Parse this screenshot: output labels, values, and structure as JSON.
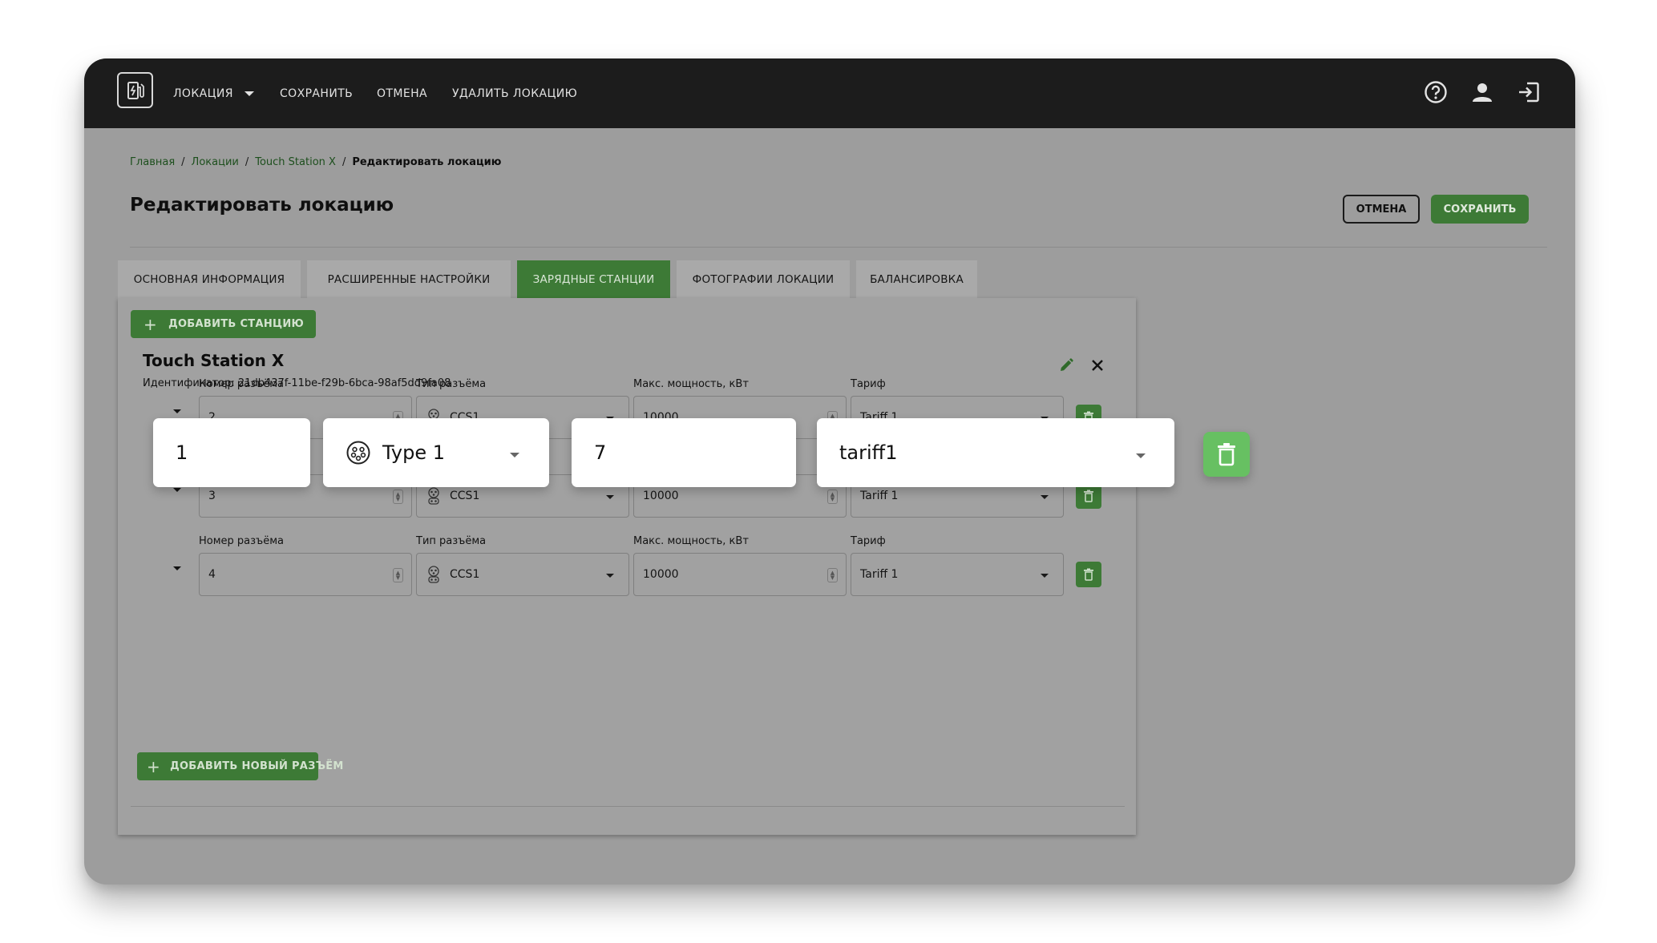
{
  "colors": {
    "accent": "#3d7a36",
    "topbar": "#1c1c1c",
    "highlight_trash": "#67c062"
  },
  "topbar": {
    "nav": {
      "location": "ЛОКАЦИЯ",
      "save": "СОХРАНИТЬ",
      "cancel": "ОТМЕНА",
      "delete_location": "УДАЛИТЬ ЛОКАЦИЮ"
    },
    "icons": [
      "charging-station-icon",
      "help-icon",
      "account-icon",
      "logout-icon"
    ]
  },
  "breadcrumb": {
    "home": "Главная",
    "locations": "Локации",
    "station": "Touch Station X",
    "current": "Редактировать локацию"
  },
  "page": {
    "title": "Редактировать локацию",
    "cancel_label": "ОТМЕНА",
    "save_label": "СОХРАНИТЬ"
  },
  "tabs": [
    {
      "label": "ОСНОВНАЯ ИНФОРМАЦИЯ",
      "active": false
    },
    {
      "label": "РАСШИРЕННЫЕ НАСТРОЙКИ",
      "active": false
    },
    {
      "label": "ЗАРЯДНЫЕ СТАНЦИИ",
      "active": true
    },
    {
      "label": "ФОТОГРАФИИ ЛОКАЦИИ",
      "active": false
    },
    {
      "label": "БАЛАНСИРОВКА",
      "active": false
    }
  ],
  "panel": {
    "add_station_label": "ДОБАВИТЬ СТАНЦИЮ",
    "add_connector_label": "ДОБАВИТЬ НОВЫЙ РАЗЪЁМ"
  },
  "station": {
    "name": "Touch Station X",
    "identifier": "Идентификатор: 21db437f-11be-f29b-6bca-98af5dd9fa08"
  },
  "labels": {
    "number": "Номер разъёма",
    "type": "Тип разъёма",
    "power": "Макс. мощность, кВт",
    "tariff": "Тариф"
  },
  "highlighted_row": {
    "number": "1",
    "type": "Type 1",
    "power": "7",
    "tariff": "tariff1"
  },
  "connectors": [
    {
      "number": "2",
      "type": "CCS1",
      "power": "10000",
      "tariff": "Tariff 1"
    },
    {
      "number": "3",
      "type": "CCS1",
      "power": "10000",
      "tariff": "Tariff 1"
    },
    {
      "number": "4",
      "type": "CCS1",
      "power": "10000",
      "tariff": "Tariff 1"
    }
  ]
}
